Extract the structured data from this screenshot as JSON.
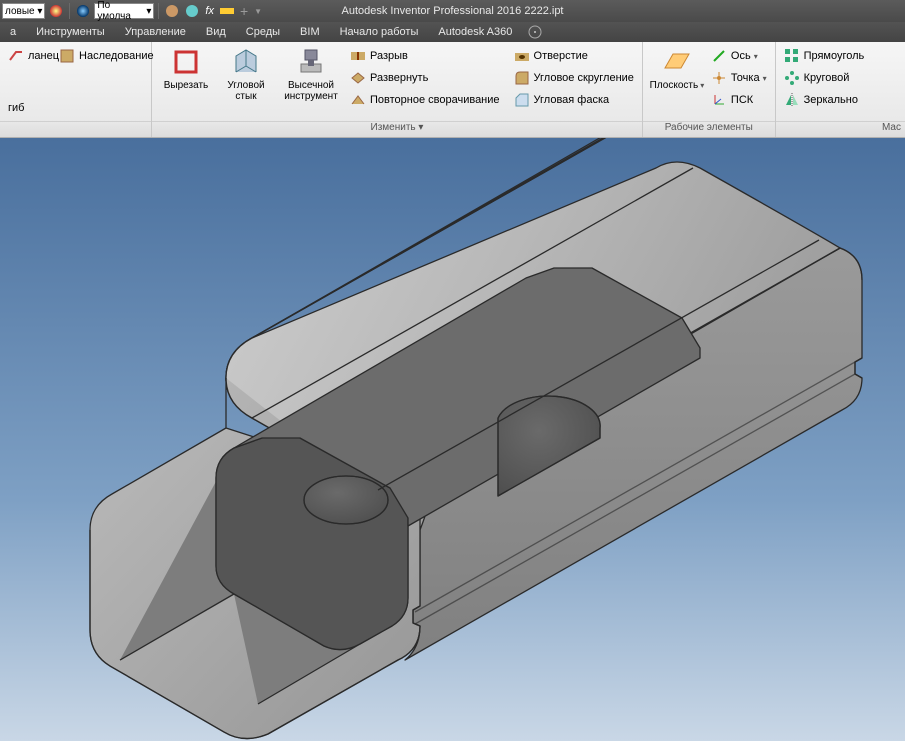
{
  "app": {
    "title": "Autodesk Inventor Professional 2016   2222.ipt"
  },
  "qat": {
    "combo_material": "ловые",
    "combo_style": "По умолча",
    "fx_label": "fx"
  },
  "tabs": {
    "items": [
      {
        "label": "а"
      },
      {
        "label": "Инструменты"
      },
      {
        "label": "Управление"
      },
      {
        "label": "Вид"
      },
      {
        "label": "Среды"
      },
      {
        "label": "BIM"
      },
      {
        "label": "Начало работы"
      },
      {
        "label": "Autodesk A360"
      }
    ]
  },
  "ribbon": {
    "panel0": {
      "btn_flange": "ланец",
      "btn_inherit": "Наследование",
      "btn_bend": "гиб"
    },
    "panel_modify": {
      "title": "Изменить ▾",
      "cut": "Вырезать",
      "corner_seam": "Угловой стык",
      "punch": "Высечной инструмент",
      "rip": "Разрыв",
      "unfold": "Развернуть",
      "refold": "Повторное сворачивание",
      "hole": "Отверстие",
      "corner_round": "Угловое скругление",
      "corner_chamfer": "Угловая фаска"
    },
    "panel_work": {
      "title": "Рабочие элементы",
      "plane": "Плоскость",
      "axis": "Ось",
      "point": "Точка",
      "ucs": "ПСК"
    },
    "panel_pattern": {
      "title": "Мас",
      "rect": "Прямоуголь",
      "circ": "Круговой",
      "mirror": "Зеркально"
    }
  }
}
